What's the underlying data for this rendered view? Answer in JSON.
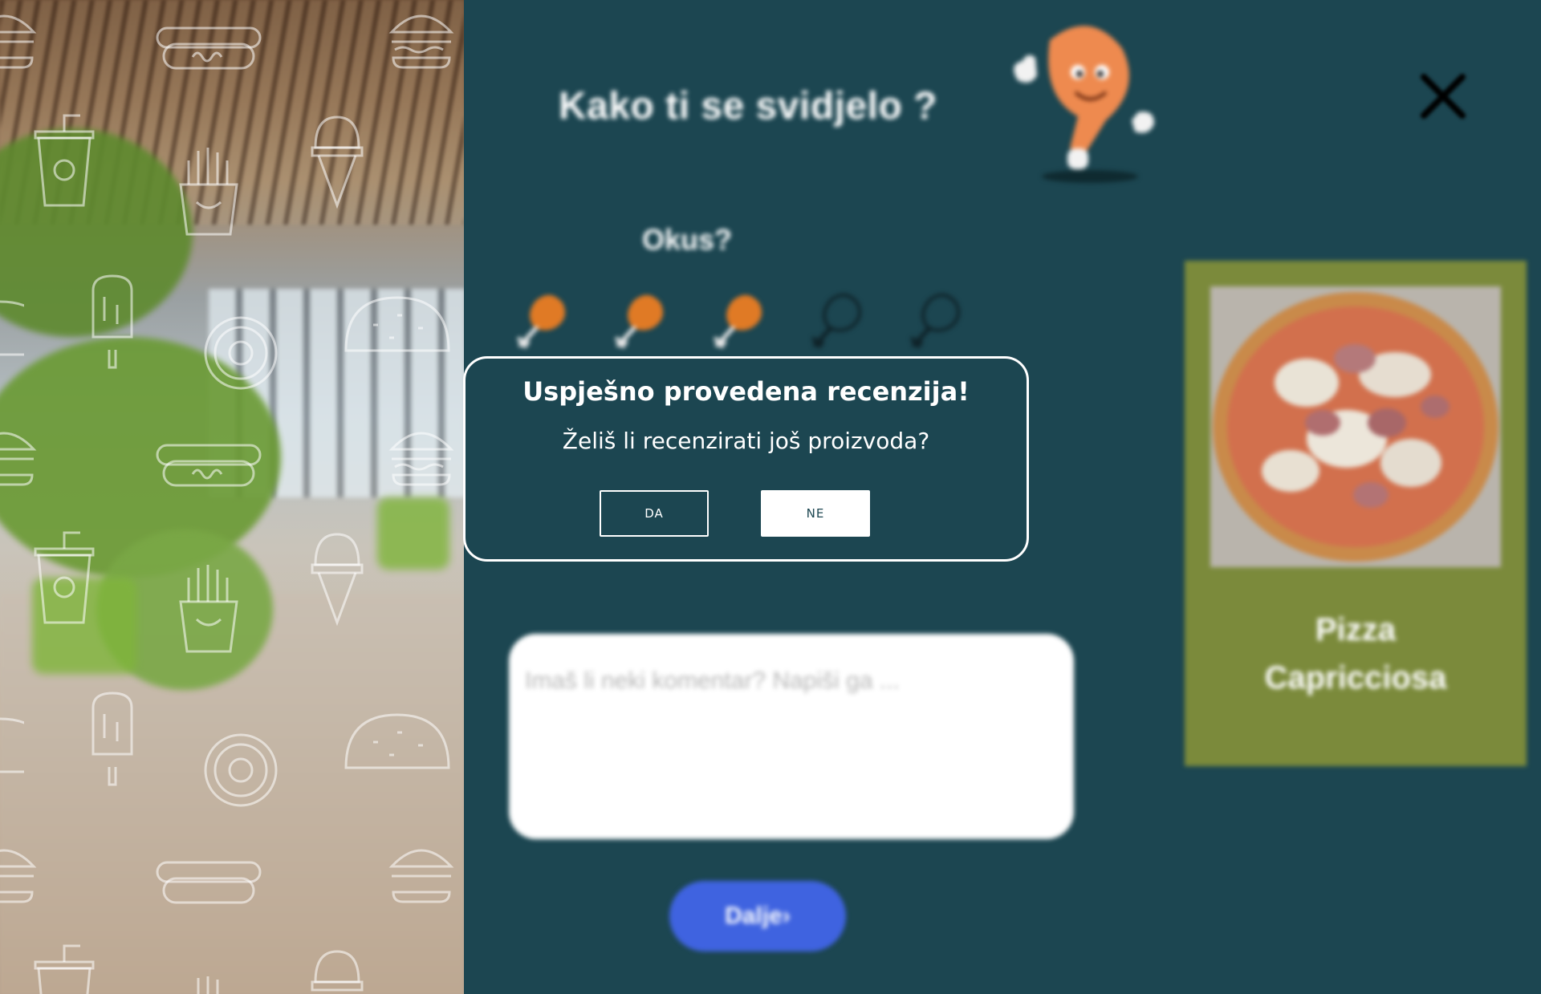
{
  "review": {
    "title": "Kako ti se svidjelo ?",
    "criterion_label": "Okus?",
    "rating_filled": 3,
    "rating_max": 5,
    "comment_placeholder": "Imaš li neki komentar? Napiši ga ...",
    "next_button": "Dalje›"
  },
  "product": {
    "name_line1": "Pizza",
    "name_line2": "Capricciosa"
  },
  "modal": {
    "title": "Uspješno provedena recenzija!",
    "question": "Želiš li recenzirati još proizvoda?",
    "yes_label": "DA",
    "no_label": "NE"
  },
  "colors": {
    "panel_background": "#1c4651",
    "product_card": "#7b8a3b",
    "next_button": "#3f63e0",
    "drumstick_filled": "#e07a25"
  }
}
